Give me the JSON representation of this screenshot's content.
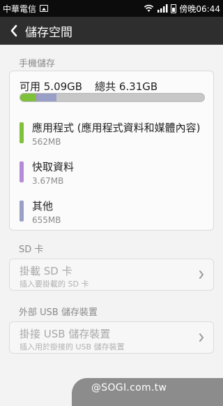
{
  "status_bar": {
    "carrier": "中華電信",
    "time": "傍晚06:44",
    "icons": [
      "image-icon",
      "wifi-icon",
      "signal-icon",
      "battery-icon"
    ]
  },
  "header": {
    "title": "儲存空間",
    "back_icon": "chevron-left-icon"
  },
  "phone_storage": {
    "section_label": "手機儲存",
    "available": "可用 5.09GB",
    "total": "總共 6.31GB",
    "usage_bar": {
      "background": "#c7c7c7",
      "segments": [
        {
          "name": "apps",
          "color": "#7ec13a",
          "fraction": 0.089
        },
        {
          "name": "cache",
          "color": "#b58ad6",
          "fraction": 0.0006
        },
        {
          "name": "other",
          "color": "#9a9fc7",
          "fraction": 0.104
        }
      ]
    },
    "items": [
      {
        "label": "應用程式 (應用程式資料和媒體內容)",
        "size": "562MB",
        "color": "#7ec13a"
      },
      {
        "label": "快取資料",
        "size": "3.67MB",
        "color": "#b58ad6"
      },
      {
        "label": "其他",
        "size": "655MB",
        "color": "#9a9fc7"
      }
    ]
  },
  "sd_card": {
    "section_label": "SD 卡",
    "action_title": "掛載 SD 卡",
    "action_sub": "插入要掛載的 SD 卡"
  },
  "usb_storage": {
    "section_label": "外部 USB 儲存裝置",
    "action_title": "掛接 USB 儲存裝置",
    "action_sub": "插入用於掛接的 USB 儲存裝置"
  },
  "watermark": "@SOGI.com.tw"
}
